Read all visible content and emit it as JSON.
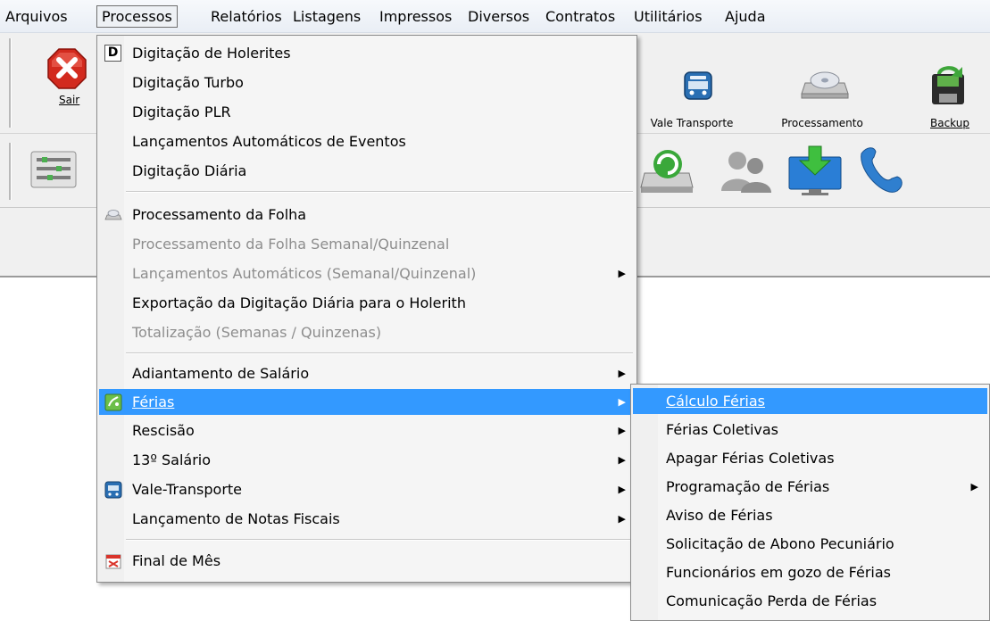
{
  "menubar": {
    "items": [
      "Arquivos",
      "Processos",
      "Relatórios",
      "Listagens",
      "Impressos",
      "Diversos",
      "Contratos",
      "Utilitários",
      "Ajuda"
    ]
  },
  "toolbar": {
    "sair": "Sair",
    "vale_transporte": "Vale Transporte",
    "processamento": "Processamento",
    "backup": "Backup"
  },
  "processos_menu": {
    "items": [
      {
        "label": "Digitação de Holerites",
        "icon": "d-letter-icon"
      },
      {
        "label": "Digitação Turbo"
      },
      {
        "label": "Digitação PLR"
      },
      {
        "label": "Lançamentos Automáticos de Eventos"
      },
      {
        "label": "Digitação Diária"
      },
      {
        "label": "Processamento da Folha",
        "icon": "cd-drive-icon"
      },
      {
        "label": "Processamento da Folha Semanal/Quinzenal",
        "disabled": true
      },
      {
        "label": "Lançamentos Automáticos (Semanal/Quinzenal)",
        "disabled": true,
        "submenu": true
      },
      {
        "label": "Exportação da Digitação Diária para o Holerith"
      },
      {
        "label": "Totalização (Semanas / Quinzenas)",
        "disabled": true
      },
      {
        "label": "Adiantamento de Salário",
        "submenu": true
      },
      {
        "label": "Férias",
        "icon": "ferias-icon",
        "submenu": true,
        "highlighted": true
      },
      {
        "label": "Rescisão",
        "submenu": true
      },
      {
        "label": "13º Salário",
        "submenu": true
      },
      {
        "label": "Vale-Transporte",
        "icon": "bus-icon",
        "submenu": true
      },
      {
        "label": "Lançamento de Notas Fiscais",
        "submenu": true
      },
      {
        "label": "Final de Mês",
        "icon": "calendar-icon"
      }
    ]
  },
  "ferias_submenu": {
    "items": [
      {
        "label": "Cálculo Férias",
        "highlighted": true
      },
      {
        "label": "Férias Coletivas"
      },
      {
        "label": "Apagar Férias Coletivas"
      },
      {
        "label": "Programação de Férias",
        "submenu": true
      },
      {
        "label": "Aviso de Férias"
      },
      {
        "label": "Solicitação de Abono Pecuniário"
      },
      {
        "label": "Funcionários em gozo de Férias"
      },
      {
        "label": "Comunicação Perda de Férias"
      }
    ]
  },
  "colors": {
    "highlight": "#3399ff",
    "disabled_text": "#8d8d8d"
  }
}
